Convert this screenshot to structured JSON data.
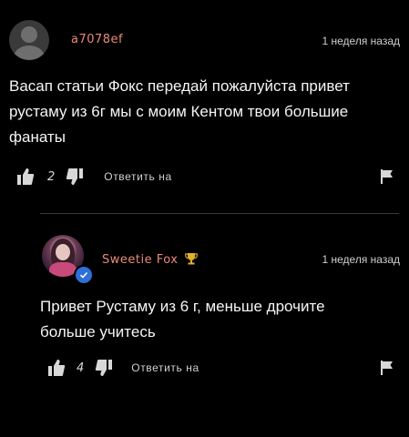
{
  "comment1": {
    "username": "a7078ef",
    "username_color": "#e88a78",
    "time": "1 неделя назад",
    "body_lines": [
      "Васап статьи Фокс передай пожалуйста привет",
      "рустаму из 6г мы с моим Кентом твои большие",
      "фанаты"
    ],
    "likes": "2",
    "reply_label": "Ответить на",
    "avatar_icon": "person-placeholder-icon"
  },
  "comment2": {
    "username": "Sweetie Fox",
    "username_color": "#e88a78",
    "badge_icon": "trophy-icon",
    "badge_color": "#e0b12a",
    "time": "1 неделя назад",
    "body_lines": [
      "Привет Рустаму из 6 г, меньше дрочите",
      "больше учитесь"
    ],
    "likes": "4",
    "reply_label": "Ответить на",
    "verified_icon": "verified-check-icon",
    "verified_color": "#2f6fd6"
  }
}
